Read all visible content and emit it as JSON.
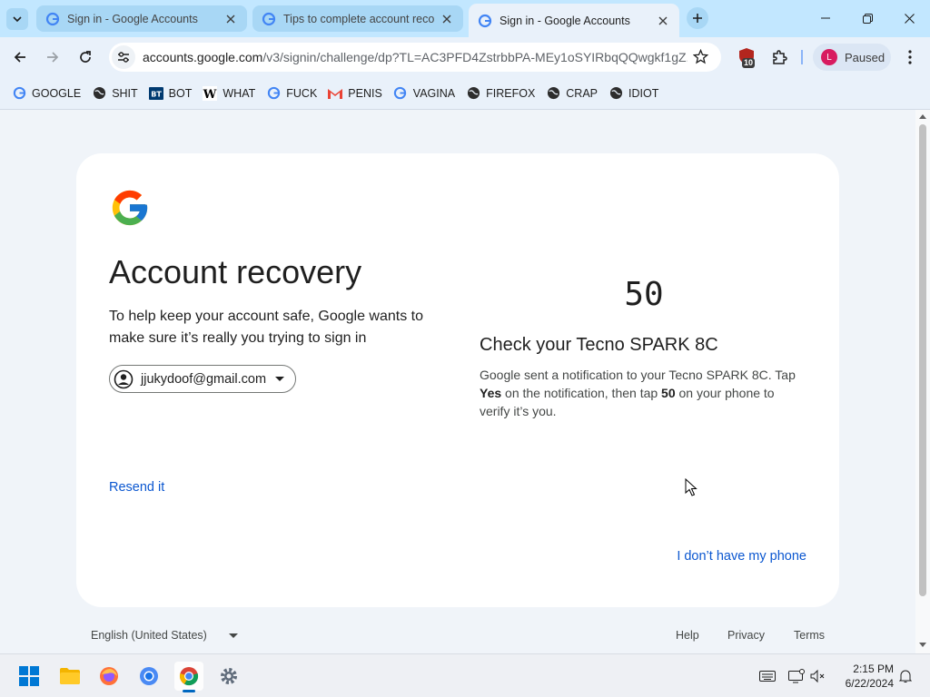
{
  "tabs": [
    {
      "title": "Sign in - Google Accounts",
      "active": false
    },
    {
      "title": "Tips to complete account recovery",
      "active": false
    },
    {
      "title": "Sign in - Google Accounts",
      "active": true
    }
  ],
  "omnibox": {
    "domain": "accounts.google.com",
    "path": "/v3/signin/challenge/dp?TL=AC3PFD4ZstrbbPA-MEy1oSYIRbqQQwgkf1gZ..."
  },
  "extensions": {
    "badge_count": "10"
  },
  "profile": {
    "initial": "L",
    "status": "Paused"
  },
  "bookmarks": [
    {
      "label": "GOOGLE",
      "icon": "google-g-icon"
    },
    {
      "label": "SHIT",
      "icon": "globe-dark-icon"
    },
    {
      "label": "BOT",
      "icon": "bt-icon"
    },
    {
      "label": "WHAT",
      "icon": "wikipedia-w-icon"
    },
    {
      "label": "FUCK",
      "icon": "google-g-icon"
    },
    {
      "label": "PENIS",
      "icon": "gmail-icon"
    },
    {
      "label": "VAGINA",
      "icon": "google-g-icon"
    },
    {
      "label": "FIREFOX",
      "icon": "globe-dark-icon"
    },
    {
      "label": "CRAP",
      "icon": "globe-dark-icon"
    },
    {
      "label": "IDIOT",
      "icon": "globe-dark-icon"
    }
  ],
  "card": {
    "title": "Account recovery",
    "subtitle": "To help keep your account safe, Google wants to make sure it’s really you trying to sign in",
    "account_email": "jjukydoof@gmail.com",
    "resend_label": "Resend it",
    "number": "50",
    "check_title": "Check your Tecno SPARK 8C",
    "check_desc": {
      "part1": "Google sent a notification to your Tecno SPARK 8C. Tap ",
      "yes": "Yes",
      "part2": " on the notification, then tap ",
      "num": "50",
      "part3": " on your phone to verify it’s you."
    },
    "no_phone_label": "I don’t have my phone"
  },
  "footer": {
    "language": "English (United States)",
    "help": "Help",
    "privacy": "Privacy",
    "terms": "Terms"
  },
  "taskbar": {
    "time": "2:15 PM",
    "date": "6/22/2024"
  },
  "colors": {
    "tab_strip": "#c2e7ff",
    "link_blue": "#0b57d0",
    "page_bg": "#f0f4f9"
  }
}
